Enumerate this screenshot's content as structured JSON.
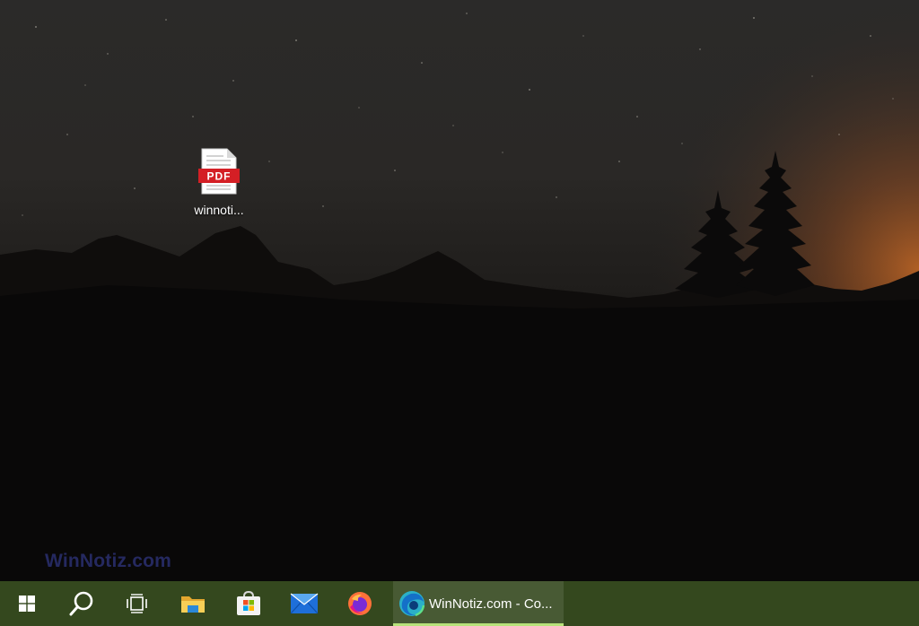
{
  "desktop": {
    "wallpaper": "night-sky-mountains",
    "icons": [
      {
        "label": "winnoti...",
        "icon": "pdf-file-icon",
        "badge_text": "PDF"
      }
    ],
    "watermark": "WinNotiz.com"
  },
  "taskbar": {
    "background_color": "#34481e",
    "items": [
      {
        "name": "start",
        "icon": "windows-logo-icon"
      },
      {
        "name": "search",
        "icon": "search-icon"
      },
      {
        "name": "task-view",
        "icon": "task-view-icon"
      },
      {
        "name": "file-explorer",
        "icon": "folder-icon"
      },
      {
        "name": "microsoft-store",
        "icon": "store-icon"
      },
      {
        "name": "mail",
        "icon": "mail-icon"
      },
      {
        "name": "firefox",
        "icon": "firefox-icon"
      }
    ],
    "active_window": {
      "icon": "edge-icon",
      "label": "WinNotiz.com - Co..."
    },
    "active_indicator_color": "#b7e27a"
  }
}
